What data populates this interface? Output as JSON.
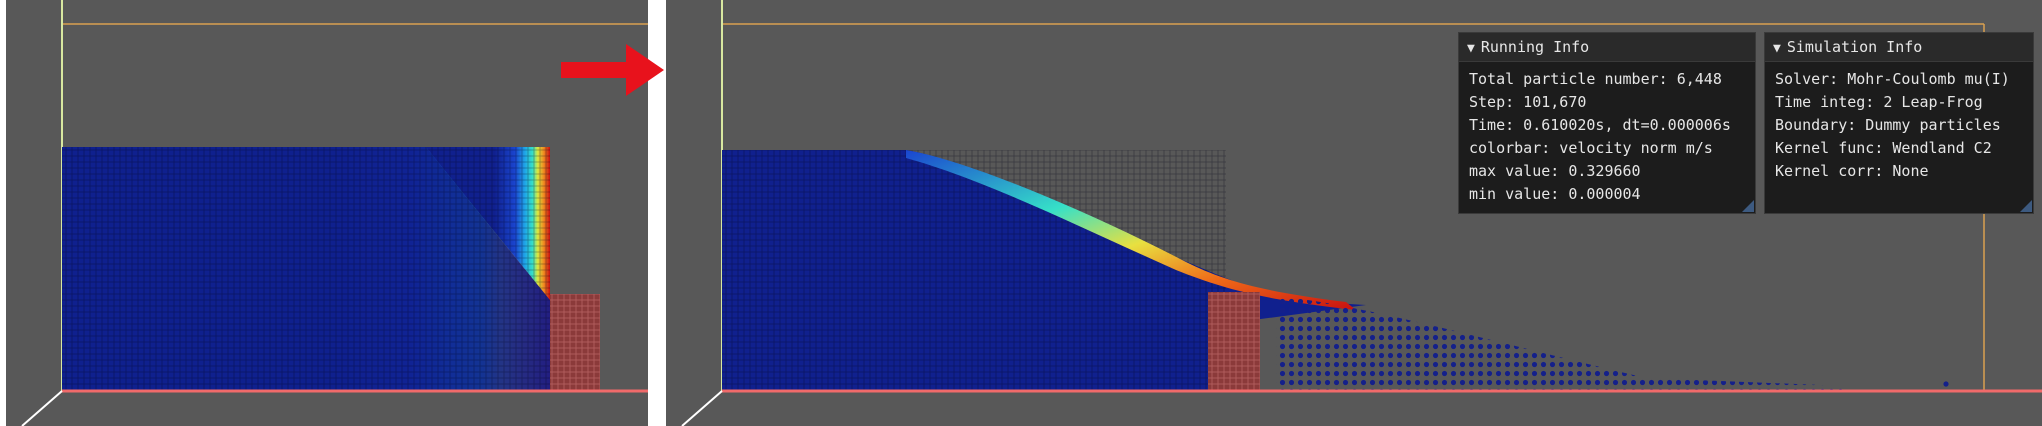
{
  "running_info": {
    "title": "Running Info",
    "lines": [
      "Total particle number: 6,448",
      "Step: 101,670",
      "Time: 0.610020s, dt=0.000006s",
      "colorbar: velocity norm m/s",
      "max value: 0.329660",
      "min value: 0.000004"
    ]
  },
  "simulation_info": {
    "title": "Simulation Info",
    "lines": [
      "Solver: Mohr-Coulomb mu(I)",
      "Time integ: 2 Leap-Frog",
      "Boundary: Dummy particles",
      "Kernel func: Wendland C2",
      "Kernel corr: None"
    ]
  },
  "icons": {
    "collapse": "triangle-down-icon",
    "transition": "red-right-arrow-icon"
  },
  "colors": {
    "viewport_bg": "#585858",
    "panel_bg": "#1c1c1c",
    "boundary_particles": "#8b3a3a",
    "bbox_line": "#d9a050",
    "axis_x": "#f06a6a",
    "axis_y": "#d8e8a0",
    "arrow": "#e8121c"
  }
}
